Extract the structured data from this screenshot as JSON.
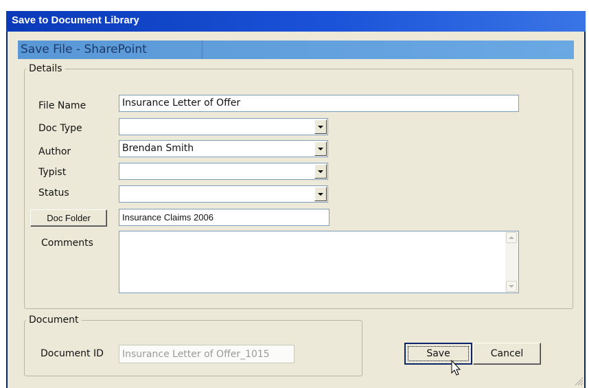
{
  "window": {
    "title": "Save to Document Library"
  },
  "banner": {
    "title": "Save File - SharePoint"
  },
  "details": {
    "legend": "Details",
    "file_name": {
      "label": "File Name",
      "value": "Insurance Letter of Offer"
    },
    "doc_type": {
      "label": "Doc Type",
      "value": ""
    },
    "author": {
      "label": "Author",
      "value": "Brendan Smith"
    },
    "typist": {
      "label": "Typist",
      "value": ""
    },
    "status": {
      "label": "Status",
      "value": ""
    },
    "doc_folder": {
      "button_label": "Doc Folder",
      "value": "Insurance Claims 2006"
    },
    "comments": {
      "label": "Comments",
      "value": ""
    }
  },
  "document": {
    "legend": "Document",
    "document_id": {
      "label": "Document ID",
      "value": "Insurance Letter of Offer_1015"
    }
  },
  "actions": {
    "save_label": "Save",
    "cancel_label": "Cancel"
  },
  "icons": {
    "combo_arrow": "chevron-down-icon",
    "scroll_up": "scroll-up-icon",
    "scroll_down": "scroll-down-icon",
    "resize": "resize-grip-icon",
    "cursor": "mouse-cursor-icon"
  },
  "colors": {
    "titlebar": "#0a3ab8",
    "banner": "#6aa8e4",
    "window_bg": "#ece9d8",
    "field_border": "#7f9db9"
  }
}
